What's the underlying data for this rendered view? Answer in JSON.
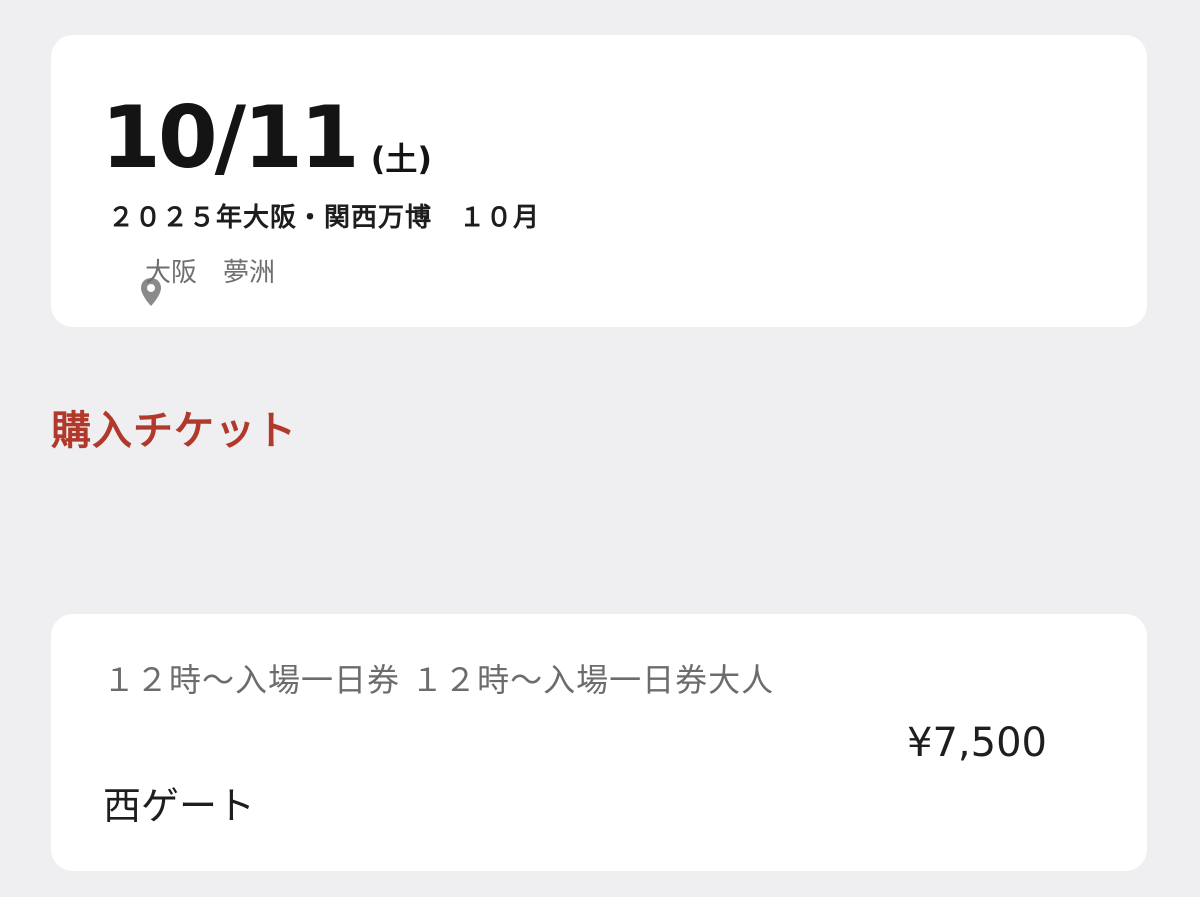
{
  "event": {
    "date": "10/11",
    "weekday": "(土)",
    "name": "２０２５年大阪・関西万博　１０月",
    "venue": "大阪　夢洲",
    "venue_icon": "location-pin-icon"
  },
  "section": {
    "title": "購入チケット",
    "title_color": "#b0392c"
  },
  "ticket": {
    "name": "１２時～入場一日券 １２時～入場一日券大人",
    "gate": "西ゲート",
    "price": "¥7,500"
  }
}
